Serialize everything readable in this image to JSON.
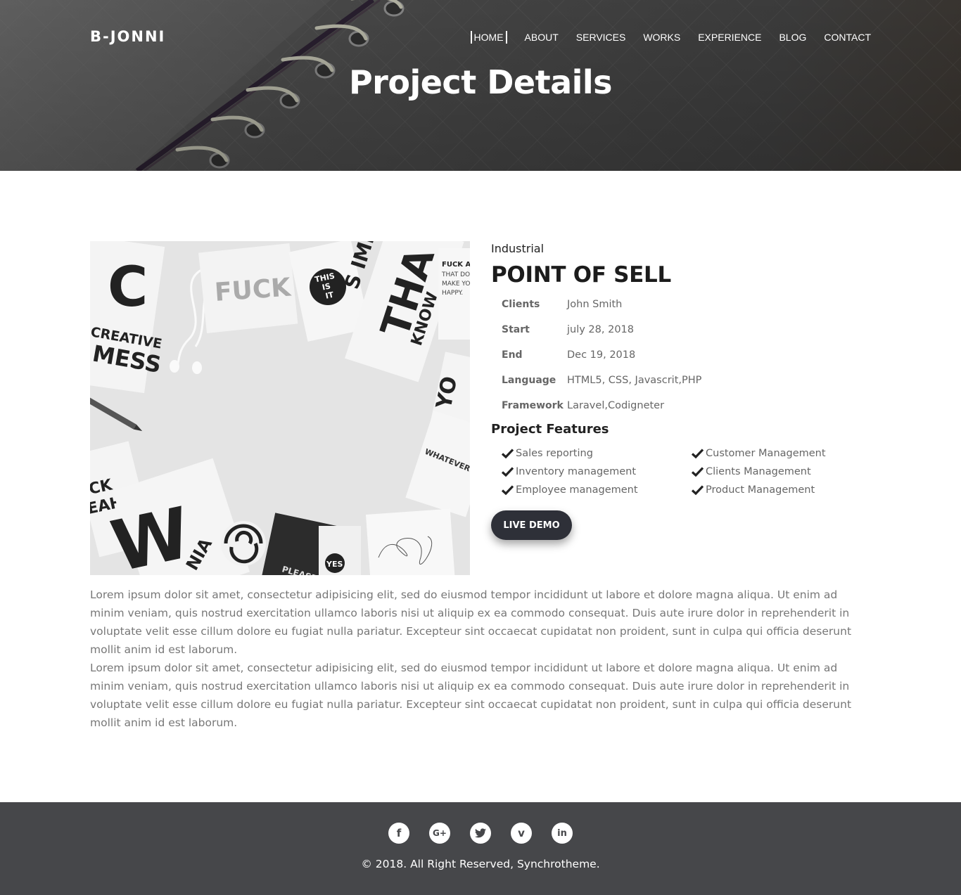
{
  "header": {
    "logo": "B-JONNI",
    "nav": [
      {
        "label": "HOME",
        "active": true
      },
      {
        "label": "ABOUT"
      },
      {
        "label": "SERVICES"
      },
      {
        "label": "WORKS"
      },
      {
        "label": "EXPERIENCE"
      },
      {
        "label": "BLOG"
      },
      {
        "label": "CONTACT"
      }
    ],
    "page_title": "Project Details"
  },
  "project": {
    "category": "Industrial",
    "name": "POINT OF SELL",
    "info": [
      {
        "label": "Clients",
        "value": "John Smith"
      },
      {
        "label": "Start",
        "value": "july 28, 2018"
      },
      {
        "label": "End",
        "value": "Dec 19, 2018"
      },
      {
        "label": "Language",
        "value": "HTML5, CSS, Javascrit,PHP"
      },
      {
        "label": "Framework",
        "value": "Laravel,Codigneter"
      }
    ],
    "features_title": "Project Features",
    "features": [
      "Sales reporting",
      "Customer Management",
      "Inventory management",
      "Clients Management",
      "Employee management",
      "Product Management"
    ],
    "live_demo_label": "LIVE DEMO",
    "image_text": {
      "c": "C",
      "creative": "CREATIVE",
      "mess": "MESS",
      "fuck": "FUCK",
      "this_is": "THIS",
      "is": "IS",
      "it": "IT",
      "important": "S IMPOR",
      "tha": "THA",
      "know": "KNOW",
      "fuck_small": "FUCK AN",
      "that_do": "THAT DO",
      "make_yo": "MAKE YO",
      "happy": "HAPPY.",
      "whatever": "WHATEVER. FU",
      "ck": "CK",
      "eah": "EAH!",
      "w": "W",
      "nia": "NIA",
      "please": "PLEASE",
      "yes": "YES",
      "yo": "YO"
    }
  },
  "description": [
    "Lorem ipsum dolor sit amet, consectetur adipisicing elit, sed do eiusmod tempor incididunt ut labore et dolore magna aliqua. Ut enim ad minim veniam, quis nostrud exercitation ullamco laboris nisi ut aliquip ex ea commodo consequat. Duis aute irure dolor in reprehenderit in voluptate velit esse cillum dolore eu fugiat nulla pariatur. Excepteur sint occaecat cupidatat non proident, sunt in culpa qui officia deserunt mollit anim id est laborum.",
    "Lorem ipsum dolor sit amet, consectetur adipisicing elit, sed do eiusmod tempor incididunt ut labore et dolore magna aliqua. Ut enim ad minim veniam, quis nostrud exercitation ullamco laboris nisi ut aliquip ex ea commodo consequat. Duis aute irure dolor in reprehenderit in voluptate velit esse cillum dolore eu fugiat nulla pariatur. Excepteur sint occaecat cupidatat non proident, sunt in culpa qui officia deserunt mollit anim id est laborum."
  ],
  "footer": {
    "social": [
      {
        "icon": "facebook-icon",
        "glyph": "f"
      },
      {
        "icon": "google-plus-icon",
        "glyph": "G+"
      },
      {
        "icon": "twitter-icon",
        "glyph": "t"
      },
      {
        "icon": "vimeo-icon",
        "glyph": "v"
      },
      {
        "icon": "linkedin-icon",
        "glyph": "in"
      }
    ],
    "copyright": "© 2018. All Right Reserved, Synchrotheme."
  },
  "colors": {
    "footer_bg": "#46474a",
    "button_bg": "#2e3038",
    "text_muted": "#666666"
  }
}
